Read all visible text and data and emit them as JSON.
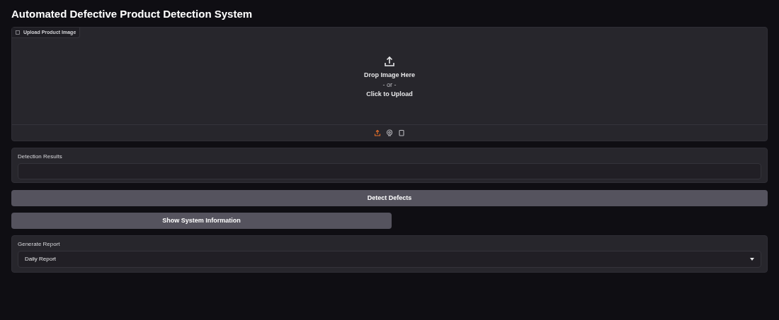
{
  "title": "Automated Defective Product Detection System",
  "upload": {
    "label": "Upload Product Image",
    "drop_text": "Drop Image Here",
    "or_text": "- or -",
    "click_text": "Click to Upload",
    "sources": [
      {
        "kind": "upload",
        "selected": true
      },
      {
        "kind": "webcam",
        "selected": false
      },
      {
        "kind": "clipboard",
        "selected": false
      }
    ]
  },
  "results": {
    "label": "Detection Results"
  },
  "buttons": [
    "Detect Defects",
    "Show System Information"
  ],
  "report": {
    "label": "Generate Report",
    "value": "Daily Report"
  }
}
